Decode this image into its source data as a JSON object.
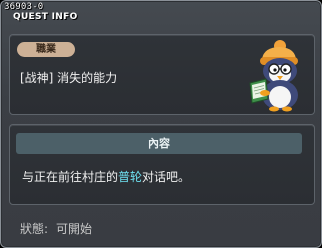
{
  "window": {
    "quest_id": "36903-0",
    "title": "QUEST INFO"
  },
  "job_panel": {
    "tag_label": "職業",
    "job_name": "[战神] 消失的能力",
    "mascot_icon": "penguin-reading-book-icon"
  },
  "content_panel": {
    "header": "內容",
    "text_before": "与正在前往村庄的",
    "npc_name": "普轮",
    "text_after": "对话吧。",
    "highlight_color": "#6ee0f0"
  },
  "status": {
    "label": "狀態:",
    "value": "可開始"
  }
}
